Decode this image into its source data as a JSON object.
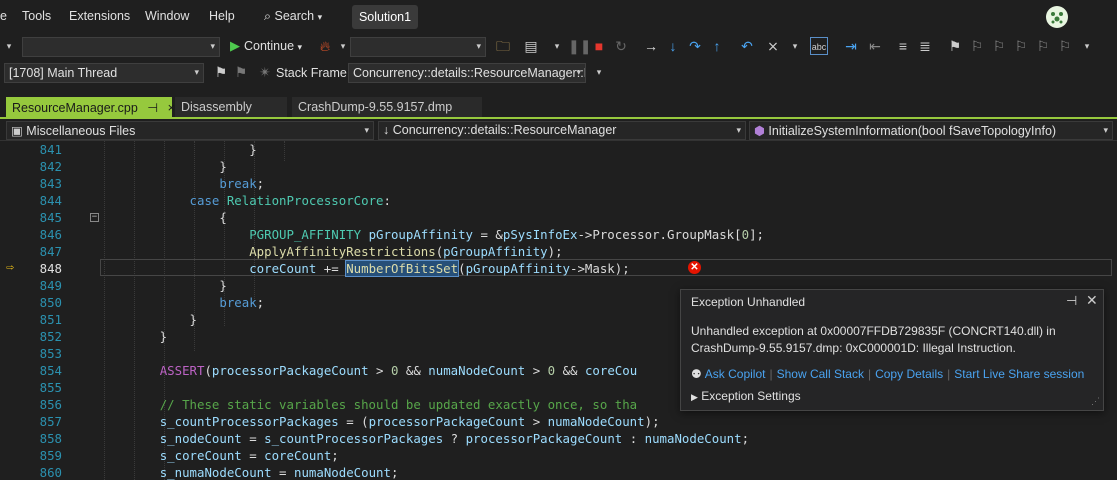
{
  "menubar": {
    "items": [
      "e",
      "Tools",
      "Extensions",
      "Window",
      "Help"
    ],
    "search_label": "Search",
    "solution": "Solution1"
  },
  "toolbar": {
    "continue_label": "Continue"
  },
  "threadbar": {
    "thread_value": "[1708] Main Thread",
    "stack_frame_label": "Stack Frame:",
    "stack_frame_value": "Concurrency::details::ResourceManager::Ir"
  },
  "tabs": [
    {
      "label": "ResourceManager.cpp",
      "pin": "⊣",
      "close": "×"
    },
    {
      "label": "Disassembly"
    },
    {
      "label": "CrashDump-9.55.9157.dmp"
    }
  ],
  "navbar": {
    "project": "Miscellaneous Files",
    "scope": "Concurrency::details::ResourceManager",
    "member": "InitializeSystemInformation(bool fSaveTopologyInfo)"
  },
  "editor": {
    "line_numbers": [
      "841",
      "842",
      "843",
      "844",
      "845",
      "846",
      "847",
      "848",
      "849",
      "850",
      "851",
      "852",
      "853",
      "854",
      "855",
      "856",
      "857",
      "858",
      "859",
      "860"
    ],
    "current_line": "848"
  },
  "exception": {
    "title": "Exception Unhandled",
    "message": "Unhandled exception at 0x00007FFDB729835F (CONCRT140.dll) in CrashDump-9.55.9157.dmp: 0xC000001D: Illegal Instruction.",
    "links": [
      "Ask Copilot",
      "Show Call Stack",
      "Copy Details",
      "Start Live Share session"
    ],
    "settings_label": "Exception Settings"
  }
}
